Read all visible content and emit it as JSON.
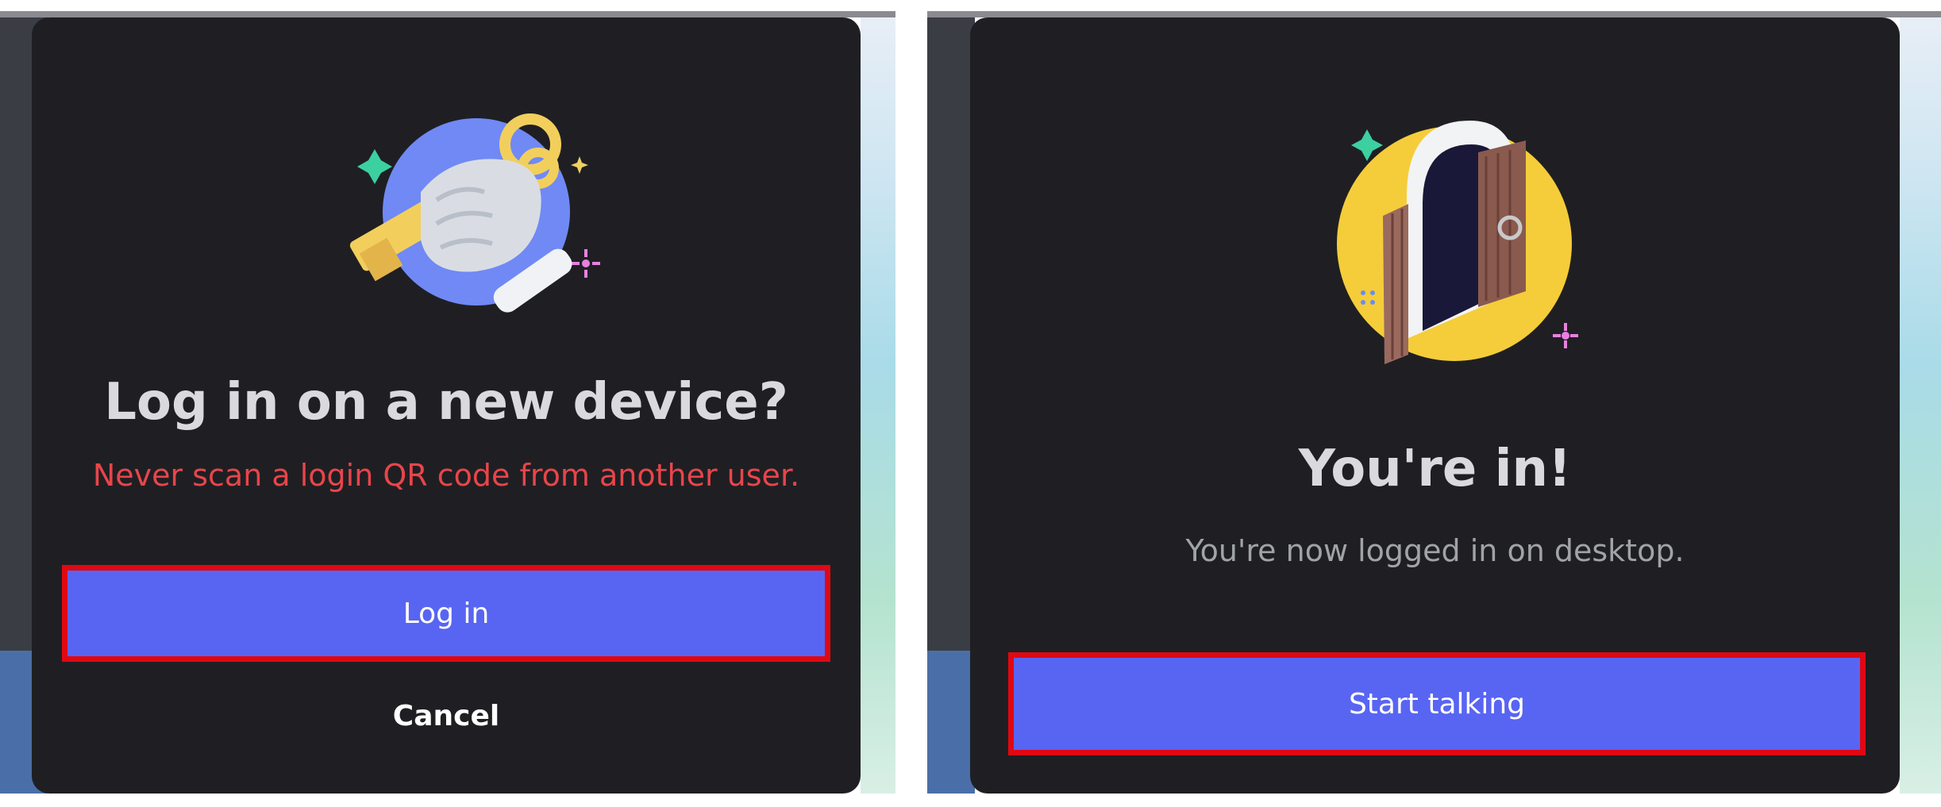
{
  "left_dialog": {
    "title": "Log in on a new device?",
    "warning": "Never scan a login QR code from another user.",
    "primary_button": "Log in",
    "secondary_button": "Cancel",
    "illustration_icon": "hand-holding-key-icon"
  },
  "right_dialog": {
    "title": "You're in!",
    "message": "You're now logged in on desktop.",
    "primary_button": "Start talking",
    "illustration_icon": "open-door-icon"
  },
  "colors": {
    "modal_bg": "#1f1f23",
    "button_bg": "#5865f2",
    "highlight_border": "#e00812",
    "warning_text": "#e8454a",
    "muted_text": "#a0a3a8"
  }
}
